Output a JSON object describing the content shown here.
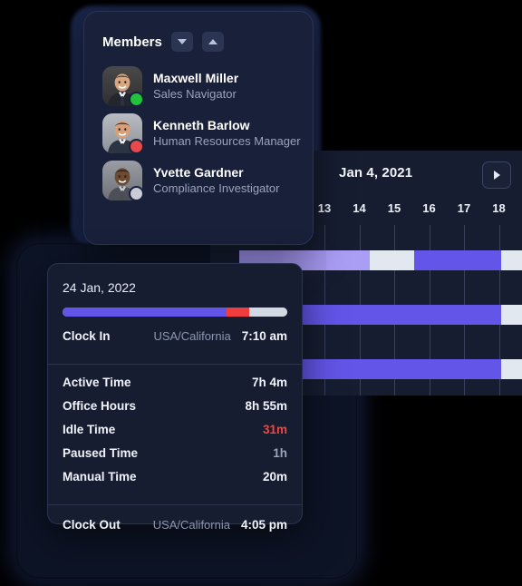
{
  "members_panel": {
    "title": "Members",
    "sort_desc_icon": "chevron-down-icon",
    "sort_asc_icon": "chevron-up-icon",
    "items": [
      {
        "name": "Maxwell Miller",
        "role": "Sales Navigator",
        "status": "online",
        "status_color": "#1fc43a"
      },
      {
        "name": "Kenneth Barlow",
        "role": "Human Resources Manager",
        "status": "busy",
        "status_color": "#e8494a"
      },
      {
        "name": "Yvette Gardner",
        "role": "Compliance Investigator",
        "status": "offline",
        "status_color": "#c8cdd9"
      }
    ]
  },
  "timeline": {
    "title": "Jan 4, 2021",
    "next_label": "▶",
    "next_icon": "arrow-right-icon",
    "day_labels": [
      "13",
      "14",
      "15",
      "16",
      "17",
      "18"
    ],
    "colors": {
      "light_purple": "#a99df0",
      "mid_purple": "#9b8df0",
      "strong_purple": "#6355e8",
      "pale": "#e2e8ef",
      "grid_line": "#39405a",
      "card_bg": "#161d31"
    },
    "rows": [
      {
        "label": "row-1",
        "segments": [
          {
            "color": "#9e92ec",
            "start": 0,
            "width": 14
          },
          {
            "color": "#a396ee",
            "start": 14,
            "width": 14
          },
          {
            "color": "#aa9df4",
            "start": 28,
            "width": 14
          },
          {
            "color": "#e2e8ef",
            "start": 42,
            "width": 14
          },
          {
            "color": "#6355e8",
            "start": 56,
            "width": 14
          },
          {
            "color": "#6355e8",
            "start": 70,
            "width": 14
          },
          {
            "color": "#e2e8ef",
            "start": 84,
            "width": 14
          }
        ]
      },
      {
        "label": "row-2",
        "segments": [
          {
            "color": "#5b4ee4",
            "start": 0,
            "width": 14
          },
          {
            "color": "#6355e8",
            "start": 14,
            "width": 14
          },
          {
            "color": "#6355e8",
            "start": 28,
            "width": 14
          },
          {
            "color": "#6355e8",
            "start": 42,
            "width": 14
          },
          {
            "color": "#6355e8",
            "start": 56,
            "width": 14
          },
          {
            "color": "#6355e8",
            "start": 70,
            "width": 14
          },
          {
            "color": "#e2e8ef",
            "start": 84,
            "width": 14
          }
        ]
      },
      {
        "label": "row-3",
        "segments": [
          {
            "color": "#9e92ec",
            "start": 0,
            "width": 14
          },
          {
            "color": "#6355e8",
            "start": 14,
            "width": 14
          },
          {
            "color": "#6355e8",
            "start": 28,
            "width": 14
          },
          {
            "color": "#6355e8",
            "start": 42,
            "width": 14
          },
          {
            "color": "#6355e8",
            "start": 56,
            "width": 14
          },
          {
            "color": "#6355e8",
            "start": 70,
            "width": 14
          },
          {
            "color": "#e2e8ef",
            "start": 84,
            "width": 14
          }
        ]
      }
    ]
  },
  "detail_card": {
    "date": "24 Jan, 2022",
    "progress": {
      "purple_pct": 73,
      "red_pct": 10,
      "grey_pct": 17,
      "purple_color": "#6355e8",
      "red_color": "#ef3d3d",
      "grey_color": "#d3d9e2"
    },
    "clock_in": {
      "label": "Clock In",
      "timezone": "USA/California",
      "value": "7:10 am"
    },
    "stats": [
      {
        "label": "Active Time",
        "value": "7h 4m",
        "style": "normal"
      },
      {
        "label": "Office Hours",
        "value": "8h 55m",
        "style": "normal"
      },
      {
        "label": "Idle Time",
        "value": "31m",
        "style": "red"
      },
      {
        "label": "Paused Time",
        "value": "1h",
        "style": "dim"
      },
      {
        "label": "Manual Time",
        "value": "20m",
        "style": "normal"
      }
    ],
    "clock_out": {
      "label": "Clock Out",
      "timezone": "USA/California",
      "value": "4:05 pm"
    }
  }
}
